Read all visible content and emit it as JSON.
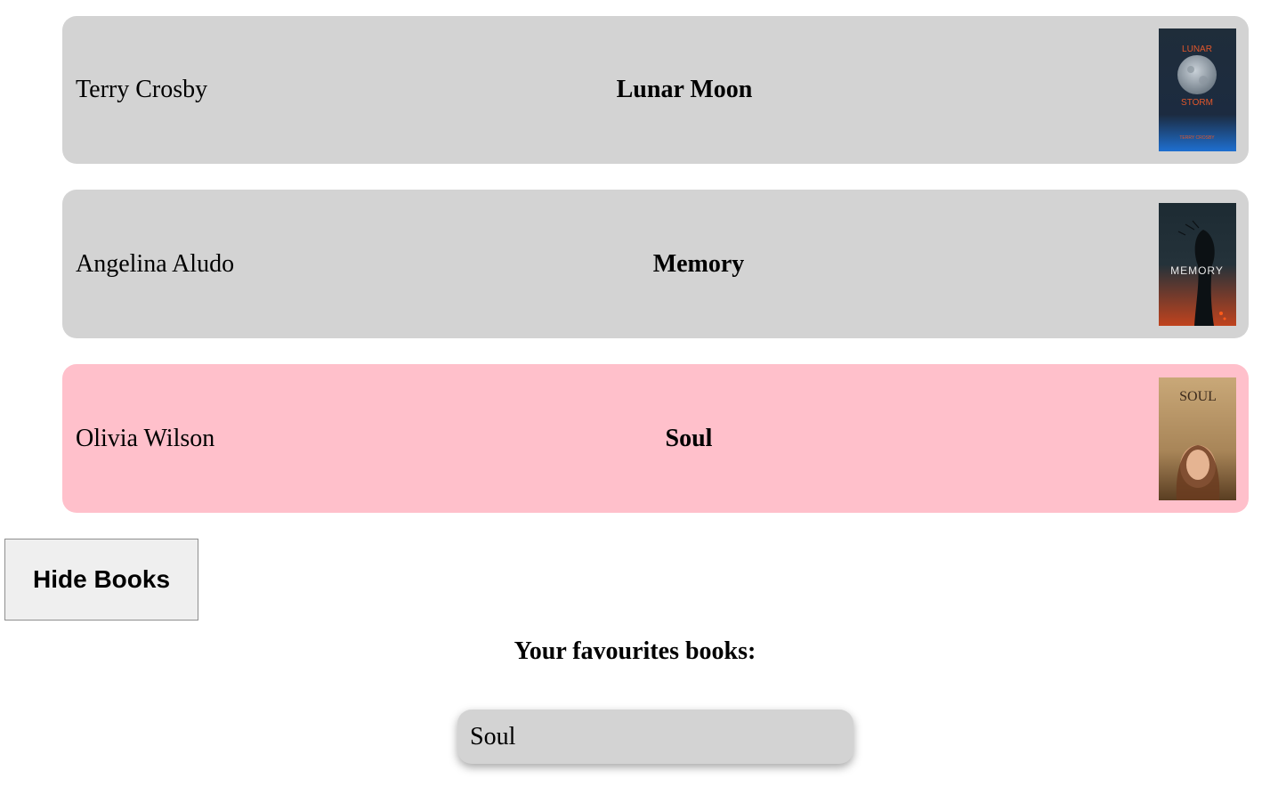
{
  "books": [
    {
      "author": "Terry Crosby",
      "title": "Lunar Moon",
      "favorite": false,
      "cover": {
        "line1": "LUNAR",
        "line2": "STORM",
        "line3": "TERRY CROSBY"
      }
    },
    {
      "author": "Angelina Aludo",
      "title": "Memory",
      "favorite": false,
      "cover": {
        "line1": "MEMORY"
      }
    },
    {
      "author": "Olivia Wilson",
      "title": "Soul",
      "favorite": true,
      "cover": {
        "line1": "SOUL"
      }
    }
  ],
  "hide_button_label": "Hide Books",
  "favorites_heading": "Your favourites books:",
  "favorites": [
    "Soul"
  ],
  "colors": {
    "row_background": "#d3d3d3",
    "favorite_row_background": "#ffc0cb"
  }
}
